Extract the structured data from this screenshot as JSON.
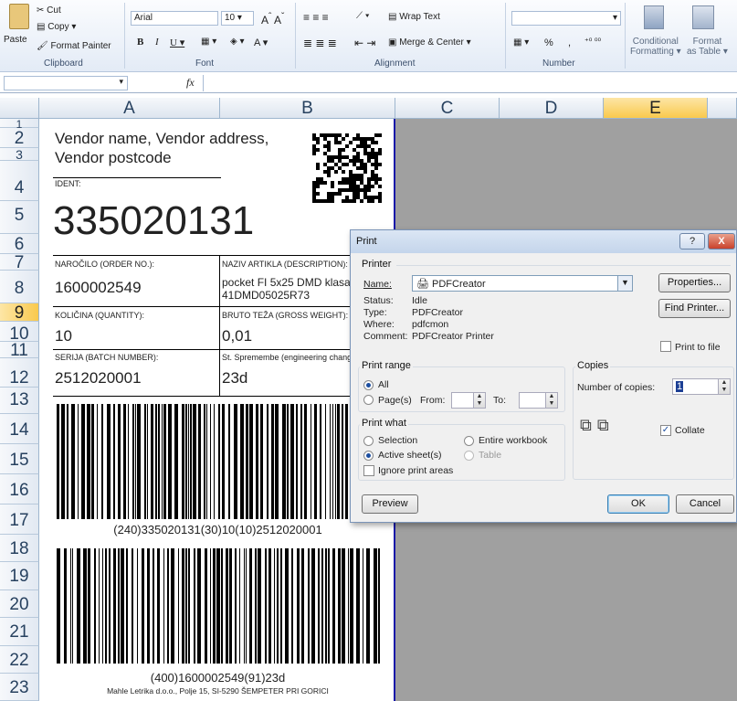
{
  "ribbon": {
    "clipboard": {
      "paste": "Paste",
      "cut": "Cut",
      "copy": "Copy",
      "format_painter": "Format Painter",
      "group": "Clipboard"
    },
    "font": {
      "name": "Arial",
      "size": "10",
      "group": "Font"
    },
    "alignment": {
      "wrap_text": "Wrap Text",
      "merge_center": "Merge & Center",
      "group": "Alignment"
    },
    "number": {
      "percent": "%",
      "comma": ",",
      "group": "Number"
    },
    "styles": {
      "conditional_1": "Conditional",
      "conditional_2": "Formatting",
      "format_1": "Format",
      "format_2": "as Table"
    }
  },
  "formula_bar": {
    "fx": "fx"
  },
  "columns": [
    "A",
    "B",
    "C",
    "D",
    "E"
  ],
  "rows": [
    "1",
    "2",
    "3",
    "4",
    "5",
    "6",
    "7",
    "8",
    "9",
    "10",
    "11",
    "12",
    "13",
    "14",
    "15",
    "16",
    "17",
    "18",
    "19",
    "20",
    "21",
    "22",
    "23"
  ],
  "selected_column": "E",
  "selected_row": "9",
  "label": {
    "vendor_line1": "Vendor name, Vendor address,",
    "vendor_line2": "Vendor postcode",
    "ident_label": "IDENT:",
    "ident_value": "335020131",
    "order_label": "NAROČILO (ORDER NO.):",
    "order_value": "1600002549",
    "desc_label": "NAZIV ARTIKLA (DESCRIPTION):",
    "desc_value1": "pocket FI 5x25 DMD klasa",
    "desc_value2": "41DMD05025R73",
    "qty_label": "KOLIČINA (QUANTITY):",
    "qty_value": "10",
    "weight_label": "BRUTO TEŽA (GROSS WEIGHT):",
    "weight_value": "0,01",
    "batch_label": "SERIJA (BATCH NUMBER):",
    "batch_value": "2512020001",
    "eng_label": "St. Spremembe (engineering change):",
    "eng_value": "23d",
    "barcode1_text": "(240)335020131(30)10(10)2512020001",
    "barcode2_text": "(400)1600002549(91)23d",
    "footer": "Mahle Letrika d.o.o., Polje 15, SI-5290 ŠEMPETER  PRI GORICI"
  },
  "dialog": {
    "title": "Print",
    "help_btn": "?",
    "close_btn": "X",
    "printer_group": "Printer",
    "name_label": "Name:",
    "name_value": "PDFCreator",
    "status_label": "Status:",
    "status_value": "Idle",
    "type_label": "Type:",
    "type_value": "PDFCreator",
    "where_label": "Where:",
    "where_value": "pdfcmon",
    "comment_label": "Comment:",
    "comment_value": "PDFCreator Printer",
    "properties_btn": "Properties...",
    "find_printer_btn": "Find Printer...",
    "print_to_file": "Print to file",
    "print_range_group": "Print range",
    "all": "All",
    "pages": "Page(s)",
    "from": "From:",
    "to": "To:",
    "copies_group": "Copies",
    "number_of_copies": "Number of copies:",
    "copies_value": "1",
    "collate": "Collate",
    "print_what_group": "Print what",
    "selection": "Selection",
    "entire_workbook": "Entire workbook",
    "active_sheets": "Active sheet(s)",
    "table": "Table",
    "ignore_print_areas": "Ignore print areas",
    "preview_btn": "Preview",
    "ok_btn": "OK",
    "cancel_btn": "Cancel"
  }
}
